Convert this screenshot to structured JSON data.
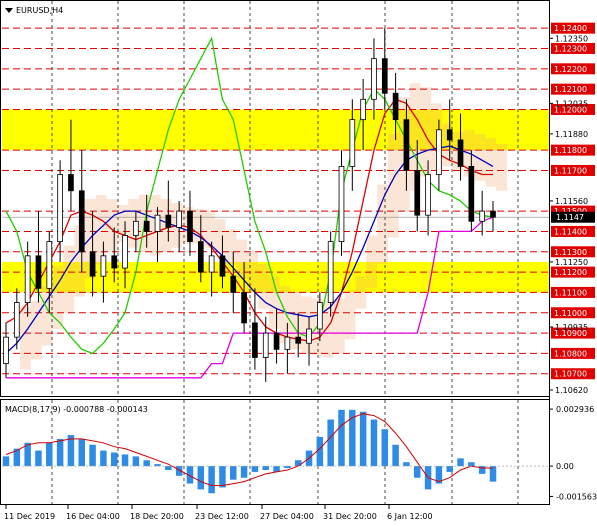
{
  "window": {
    "symbol_label": "EURUSD,H4"
  },
  "colors": {
    "candle": "#000000",
    "band": "#ffff00",
    "level_line": "#e00000",
    "level_tag": "#e00000",
    "current_tag": "#000000",
    "ma_red": "#e00000",
    "ma_blue": "#0000c0",
    "green": "#22cc00",
    "magenta": "#e000e0",
    "cloud": "#f2a070",
    "macd_hist": "#2e8be6",
    "macd_signal": "#d40000",
    "grid": "#000000"
  },
  "chart_data": [
    {
      "type": "line",
      "title": "EURUSD,H4",
      "ylim": [
        1.1062,
        1.1245
      ],
      "price_axis_ticks": [
        1.1235,
        1.1203,
        1.1188,
        1.1155,
        1.1125,
        1.1093,
        1.1062
      ],
      "current_price": 1.1147,
      "current_price_label": "1.1147",
      "levels": [
        {
          "value": 1.124,
          "label": "1.12400"
        },
        {
          "value": 1.123,
          "label": "1.12300"
        },
        {
          "value": 1.122,
          "label": "1.12200"
        },
        {
          "value": 1.121,
          "label": "1.12100"
        },
        {
          "value": 1.12,
          "label": "1.12000"
        },
        {
          "value": 1.118,
          "label": "1.11800"
        },
        {
          "value": 1.117,
          "label": "1.11700"
        },
        {
          "value": 1.115,
          "label": "1.11500"
        },
        {
          "value": 1.114,
          "label": "1.11400"
        },
        {
          "value": 1.113,
          "label": "1.11300"
        },
        {
          "value": 1.112,
          "label": "1.11200"
        },
        {
          "value": 1.111,
          "label": "1.11100"
        },
        {
          "value": 1.11,
          "label": "1.11000"
        },
        {
          "value": 1.109,
          "label": "1.10900"
        },
        {
          "value": 1.108,
          "label": "1.10800"
        },
        {
          "value": 1.107,
          "label": "1.10700"
        }
      ],
      "price_axis_plain": [
        {
          "value": 1.1235,
          "label": "1.12350"
        },
        {
          "value": 1.1203,
          "label": "1.12035"
        },
        {
          "value": 1.1188,
          "label": "1.11880"
        },
        {
          "value": 1.1155,
          "label": "1.11560"
        },
        {
          "value": 1.1125,
          "label": "1.11250"
        },
        {
          "value": 1.1093,
          "label": "1.10935"
        },
        {
          "value": 1.1062,
          "label": "1.10620"
        }
      ],
      "bands": [
        {
          "from": 1.118,
          "to": 1.12
        },
        {
          "from": 1.111,
          "to": 1.1125
        }
      ],
      "x_labels": [
        "11 Dec 2019",
        "16 Dec 04:00",
        "18 Dec 20:00",
        "23 Dec 12:00",
        "27 Dec 04:00",
        "31 Dec 20:00",
        "6 Jan 12:00"
      ],
      "candles": [
        [
          1.1075,
          1.1095,
          1.1068,
          1.1088
        ],
        [
          1.1088,
          1.1112,
          1.1082,
          1.1105
        ],
        [
          1.1105,
          1.1135,
          1.1098,
          1.1128
        ],
        [
          1.1128,
          1.115,
          1.1105,
          1.1112
        ],
        [
          1.1112,
          1.114,
          1.11,
          1.1135
        ],
        [
          1.1135,
          1.1175,
          1.1125,
          1.1168
        ],
        [
          1.1168,
          1.1195,
          1.115,
          1.116
        ],
        [
          1.116,
          1.118,
          1.112,
          1.113
        ],
        [
          1.113,
          1.115,
          1.1108,
          1.1118
        ],
        [
          1.1118,
          1.1135,
          1.1105,
          1.1128
        ],
        [
          1.1128,
          1.1142,
          1.1115,
          1.1122
        ],
        [
          1.1122,
          1.1145,
          1.1112,
          1.1138
        ],
        [
          1.1138,
          1.115,
          1.113,
          1.1145
        ],
        [
          1.1145,
          1.1158,
          1.1132,
          1.114
        ],
        [
          1.114,
          1.1152,
          1.1125,
          1.1148
        ],
        [
          1.1148,
          1.1165,
          1.1135,
          1.1142
        ],
        [
          1.1142,
          1.1155,
          1.113,
          1.115
        ],
        [
          1.115,
          1.116,
          1.1128,
          1.1135
        ],
        [
          1.1135,
          1.1148,
          1.1115,
          1.112
        ],
        [
          1.112,
          1.1135,
          1.1108,
          1.1128
        ],
        [
          1.1128,
          1.1138,
          1.1112,
          1.1118
        ],
        [
          1.1118,
          1.113,
          1.11,
          1.111
        ],
        [
          1.111,
          1.1125,
          1.109,
          1.1095
        ],
        [
          1.1095,
          1.1112,
          1.1072,
          1.1078
        ],
        [
          1.1078,
          1.1098,
          1.1066,
          1.109
        ],
        [
          1.109,
          1.1102,
          1.1075,
          1.1082
        ],
        [
          1.1082,
          1.1095,
          1.107,
          1.1088
        ],
        [
          1.1088,
          1.11,
          1.1078,
          1.1085
        ],
        [
          1.1085,
          1.1098,
          1.1074,
          1.1092
        ],
        [
          1.1092,
          1.111,
          1.1086,
          1.1105
        ],
        [
          1.1105,
          1.114,
          1.1098,
          1.1135
        ],
        [
          1.1135,
          1.118,
          1.1128,
          1.1172
        ],
        [
          1.1172,
          1.1205,
          1.116,
          1.1195
        ],
        [
          1.1195,
          1.1215,
          1.118,
          1.1205
        ],
        [
          1.1205,
          1.1235,
          1.1195,
          1.1225
        ],
        [
          1.1225,
          1.124,
          1.12,
          1.1208
        ],
        [
          1.1208,
          1.1218,
          1.1185,
          1.1195
        ],
        [
          1.1195,
          1.1205,
          1.116,
          1.117
        ],
        [
          1.117,
          1.1185,
          1.114,
          1.1148
        ],
        [
          1.1148,
          1.1175,
          1.1138,
          1.1168
        ],
        [
          1.1168,
          1.1195,
          1.116,
          1.119
        ],
        [
          1.119,
          1.1205,
          1.1175,
          1.1185
        ],
        [
          1.1185,
          1.1198,
          1.1165,
          1.1172
        ],
        [
          1.1172,
          1.118,
          1.114,
          1.1145
        ],
        [
          1.1145,
          1.116,
          1.1138,
          1.115
        ],
        [
          1.115,
          1.1155,
          1.114,
          1.1147
        ]
      ],
      "series": [
        {
          "color_key": "ma_red",
          "values": [
            1.1095,
            1.1098,
            1.1105,
            1.1115,
            1.1125,
            1.1135,
            1.1148,
            1.115,
            1.1148,
            1.1145,
            1.114,
            1.1138,
            1.1136,
            1.1138,
            1.114,
            1.1142,
            1.1143,
            1.1142,
            1.1138,
            1.1132,
            1.1125,
            1.1118,
            1.111,
            1.11,
            1.1093,
            1.109,
            1.1088,
            1.1087,
            1.1086,
            1.1088,
            1.1095,
            1.111,
            1.113,
            1.1155,
            1.118,
            1.1198,
            1.1205,
            1.1203,
            1.1195,
            1.1185,
            1.1178,
            1.1175,
            1.1173,
            1.117,
            1.1168,
            1.1168
          ]
        },
        {
          "color_key": "ma_blue",
          "values": [
            1.108,
            1.1085,
            1.1092,
            1.11,
            1.1108,
            1.1116,
            1.1125,
            1.1132,
            1.1138,
            1.1143,
            1.1148,
            1.115,
            1.115,
            1.1148,
            1.1146,
            1.1144,
            1.1142,
            1.114,
            1.1137,
            1.1133,
            1.1128,
            1.1122,
            1.1116,
            1.111,
            1.1105,
            1.1102,
            1.11,
            1.1099,
            1.1098,
            1.1099,
            1.1103,
            1.111,
            1.112,
            1.1132,
            1.1145,
            1.1158,
            1.1168,
            1.1175,
            1.1178,
            1.118,
            1.1181,
            1.1182,
            1.118,
            1.1178,
            1.1175,
            1.1172
          ]
        },
        {
          "color_key": "green",
          "values": [
            1.115,
            1.114,
            1.112,
            1.111,
            1.11,
            1.1095,
            1.1088,
            1.1082,
            1.108,
            1.1085,
            1.1092,
            1.11,
            1.112,
            1.115,
            1.117,
            1.119,
            1.1205,
            1.1215,
            1.1225,
            1.1235,
            1.1205,
            1.1195,
            1.117,
            1.1145,
            1.113,
            1.111,
            1.1098,
            1.109,
            1.1088,
            1.1095,
            1.112,
            1.116,
            1.118,
            1.12,
            1.121,
            1.1205,
            1.1195,
            1.1185,
            1.1175,
            1.1165,
            1.116,
            1.1158,
            1.1155,
            1.115,
            1.1148,
            1.1147
          ]
        },
        {
          "color_key": "magenta",
          "values": [
            1.1068,
            1.1068,
            1.1068,
            1.1068,
            1.1068,
            1.1068,
            1.1068,
            1.1068,
            1.1068,
            1.1068,
            1.1068,
            1.1068,
            1.1068,
            1.1068,
            1.1068,
            1.1068,
            1.1068,
            1.1068,
            1.1068,
            1.1075,
            1.1075,
            1.109,
            1.109,
            1.109,
            1.109,
            1.109,
            1.109,
            1.109,
            1.109,
            1.109,
            1.109,
            1.109,
            1.109,
            1.109,
            1.109,
            1.109,
            1.109,
            1.109,
            1.109,
            1.111,
            1.114,
            1.114,
            1.114,
            1.114,
            1.1145,
            1.1147
          ]
        }
      ]
    },
    {
      "type": "bar",
      "title": "MACD(8,17,9) -0.000788 -0.000143",
      "ylim": [
        -0.00185,
        0.0032
      ],
      "y_ticks": [
        {
          "value": 0.002936,
          "label": "0.002936"
        },
        {
          "value": 0.0,
          "label": "0.00"
        },
        {
          "value": -0.001563,
          "label": "-0.001563"
        }
      ],
      "series": [
        {
          "name": "histogram",
          "values": [
            0.0005,
            0.0009,
            0.0012,
            0.0008,
            0.0012,
            0.0014,
            0.0016,
            0.0014,
            0.0011,
            0.0008,
            0.0007,
            0.0006,
            0.0005,
            0.0003,
            0.0001,
            -0.0002,
            -0.0005,
            -0.0009,
            -0.0012,
            -0.0014,
            -0.0011,
            -0.0007,
            -0.0006,
            -0.0003,
            -0.0002,
            -0.0003,
            -0.0001,
            0.0003,
            0.0008,
            0.0015,
            0.0024,
            0.0029,
            0.0029,
            0.0028,
            0.0024,
            0.0019,
            0.0011,
            0.0002,
            -0.0006,
            -0.0012,
            -0.0009,
            -0.0003,
            0.0004,
            0.0002,
            -0.0004,
            -0.0008
          ]
        },
        {
          "name": "signal",
          "values": [
            0.0006,
            0.0008,
            0.0011,
            0.0012,
            0.0012,
            0.0013,
            0.0014,
            0.0014,
            0.0013,
            0.0012,
            0.001,
            0.0009,
            0.0007,
            0.0005,
            0.0003,
            0.0001,
            -0.0002,
            -0.0005,
            -0.0008,
            -0.001,
            -0.001,
            -0.0009,
            -0.0008,
            -0.0006,
            -0.0004,
            -0.0003,
            -0.0002,
            0.0,
            0.0004,
            0.0009,
            0.0015,
            0.0021,
            0.0025,
            0.0027,
            0.0026,
            0.0023,
            0.0017,
            0.001,
            0.0002,
            -0.0006,
            -0.0008,
            -0.0006,
            -0.0002,
            0.0,
            -0.0001,
            -0.0001
          ]
        }
      ]
    }
  ]
}
